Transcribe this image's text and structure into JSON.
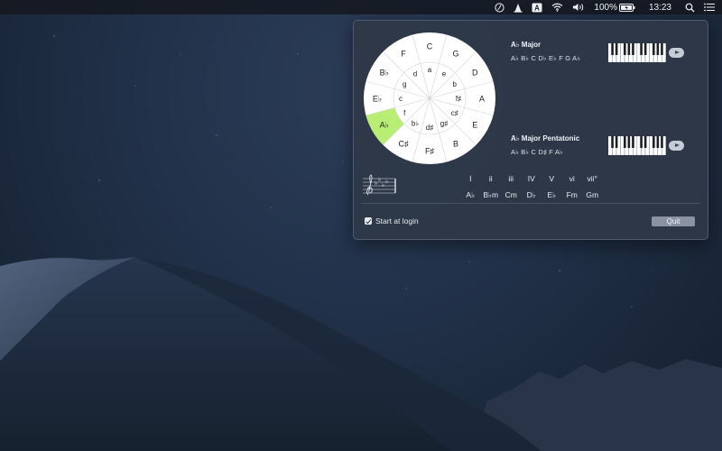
{
  "menubar": {
    "icons": [
      "circle-of-fifths-icon",
      "cone-icon",
      "keyboard-a-icon",
      "wifi-icon",
      "volume-icon",
      "battery-icon",
      "search-icon",
      "menu-list-icon"
    ],
    "keyboard_letter": "A",
    "battery_percent": "100%",
    "time": "13:23"
  },
  "wheel": {
    "selected_color": "#b9ee75",
    "major_keys": [
      "C",
      "G",
      "D",
      "A",
      "E",
      "B",
      "F♯",
      "C♯",
      "A♭",
      "E♭",
      "B♭",
      "F"
    ],
    "minor_keys": [
      "a",
      "e",
      "b",
      "f♯",
      "c♯",
      "g♯",
      "d♯",
      "b♭",
      "f",
      "c",
      "g",
      "d"
    ],
    "selected": "A♭"
  },
  "scales": [
    {
      "title": "A♭ Major",
      "notes": "A♭ B♭ C  D♭ E♭ F  G  A♭"
    },
    {
      "title": "A♭ Major Pentatonic",
      "notes": "A♭ B♭ C  D♯ F  A♭"
    }
  ],
  "chords": {
    "roman": [
      "I",
      "ii",
      "iii",
      "IV",
      "V",
      "vi",
      "vii°"
    ],
    "names": [
      "A♭",
      "B♭m",
      "Cm",
      "D♭",
      "E♭",
      "Fm",
      "Gm"
    ]
  },
  "settings": {
    "start_at_login_label": "Start at login",
    "start_at_login": true,
    "quit_label": "Quit"
  }
}
